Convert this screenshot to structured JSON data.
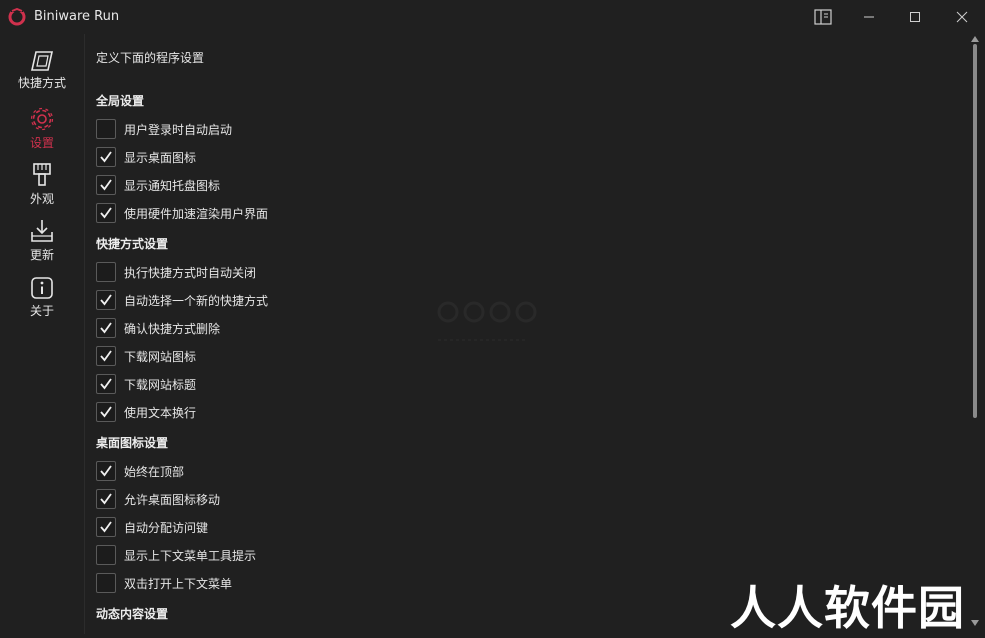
{
  "window": {
    "title": "Biniware Run"
  },
  "sidebar": {
    "items": [
      {
        "label": "快捷方式",
        "icon": "shortcut-icon"
      },
      {
        "label": "设置",
        "icon": "gear-icon",
        "active": true
      },
      {
        "label": "外观",
        "icon": "brush-icon"
      },
      {
        "label": "更新",
        "icon": "download-icon"
      },
      {
        "label": "关于",
        "icon": "info-icon"
      }
    ]
  },
  "main": {
    "page_title": "定义下面的程序设置",
    "sections": [
      {
        "title": "全局设置",
        "options": [
          {
            "label": "用户登录时自动启动",
            "checked": false
          },
          {
            "label": "显示桌面图标",
            "checked": true
          },
          {
            "label": "显示通知托盘图标",
            "checked": true
          },
          {
            "label": "使用硬件加速渲染用户界面",
            "checked": true
          }
        ]
      },
      {
        "title": "快捷方式设置",
        "options": [
          {
            "label": "执行快捷方式时自动关闭",
            "checked": false
          },
          {
            "label": "自动选择一个新的快捷方式",
            "checked": true
          },
          {
            "label": "确认快捷方式删除",
            "checked": true
          },
          {
            "label": "下载网站图标",
            "checked": true
          },
          {
            "label": "下载网站标题",
            "checked": true
          },
          {
            "label": "使用文本换行",
            "checked": true
          }
        ]
      },
      {
        "title": "桌面图标设置",
        "options": [
          {
            "label": "始终在顶部",
            "checked": true
          },
          {
            "label": "允许桌面图标移动",
            "checked": true
          },
          {
            "label": "自动分配访问键",
            "checked": true
          },
          {
            "label": "显示上下文菜单工具提示",
            "checked": false
          },
          {
            "label": "双击打开上下文菜单",
            "checked": false
          }
        ]
      },
      {
        "title": "动态内容设置",
        "options": []
      }
    ]
  },
  "watermark": {
    "text": "人人软件园"
  },
  "colors": {
    "accent": "#d0314d",
    "background": "#202020",
    "text": "#e6e6e6"
  }
}
